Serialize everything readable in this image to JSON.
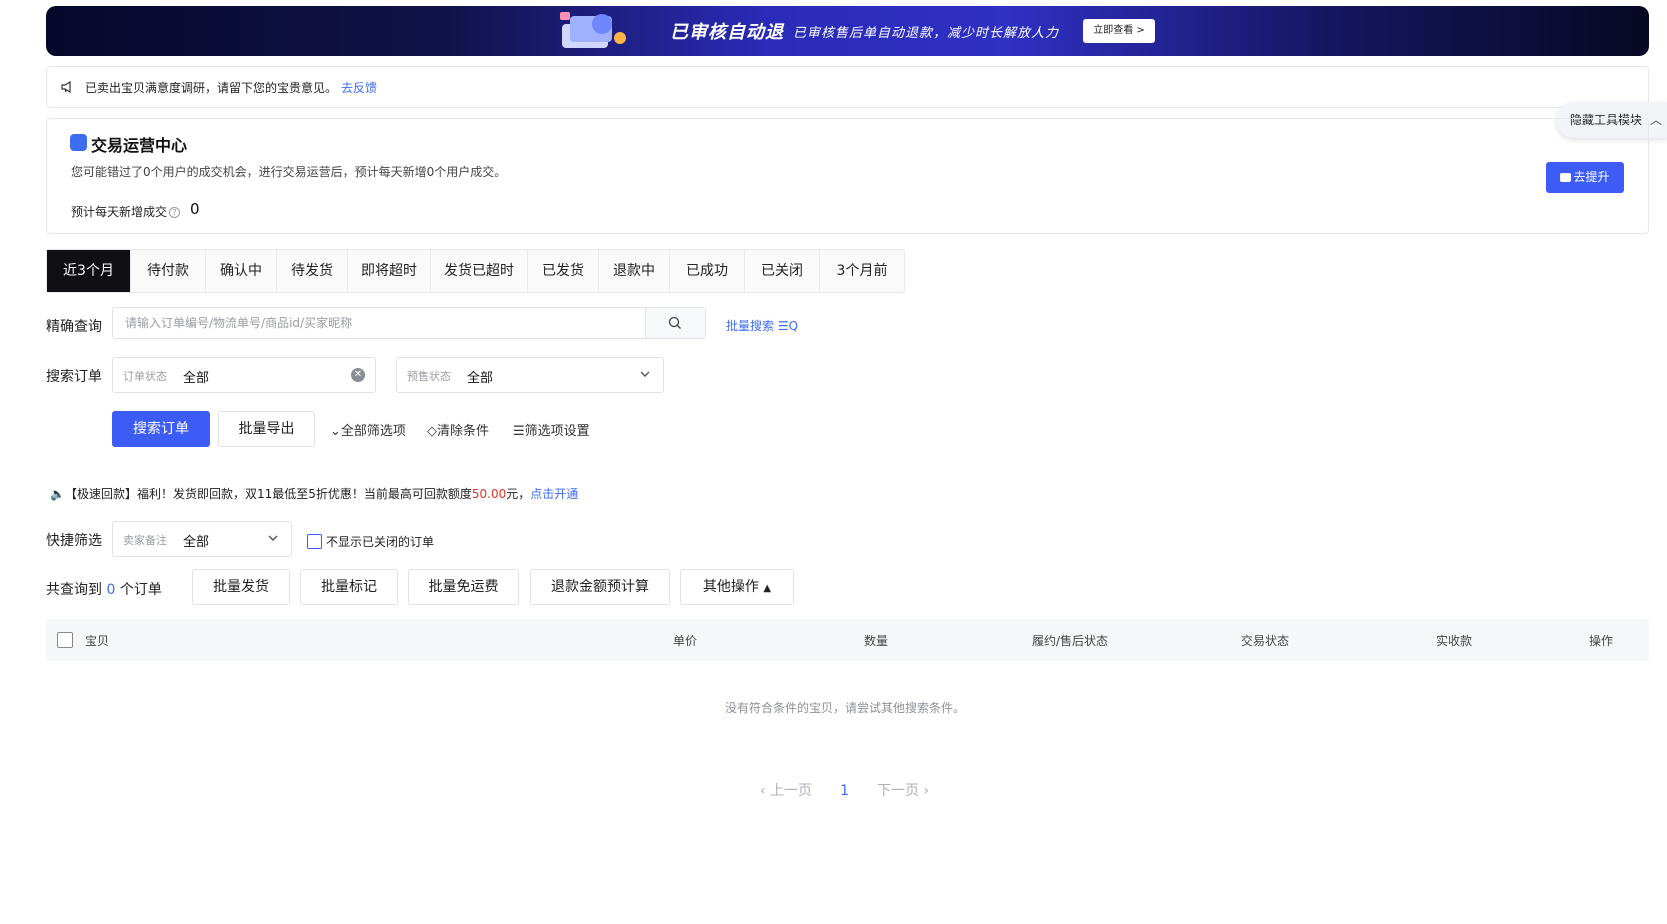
{
  "banner": {
    "title": "已审核自动退",
    "subtitle": "已审核售后单自动退款，减少时长解放人力",
    "button": "立即查看 >"
  },
  "feedback": {
    "text": "已卖出宝贝满意度调研，请留下您的宝贵意见。",
    "link": "去反馈"
  },
  "tools": {
    "hide_label": "隐藏工具模块"
  },
  "trade_center": {
    "title": "交易运营中心",
    "description": "您可能错过了0个用户的成交机会，进行交易运营后，预计每天新增0个用户成交。",
    "metric_label": "预计每天新增成交",
    "metric_value": "0",
    "button": "去提升"
  },
  "tabs": [
    {
      "label": "近3个月",
      "active": true
    },
    {
      "label": "待付款"
    },
    {
      "label": "确认中"
    },
    {
      "label": "待发货"
    },
    {
      "label": "即将超时"
    },
    {
      "label": "发货已超时"
    },
    {
      "label": "已发货"
    },
    {
      "label": "退款中"
    },
    {
      "label": "已成功"
    },
    {
      "label": "已关闭"
    },
    {
      "label": "3个月前"
    }
  ],
  "precise": {
    "label": "精确查询",
    "placeholder": "请输入订单编号/物流单号/商品id/买家昵称",
    "batch_search": "批量搜索"
  },
  "search": {
    "label": "搜索订单",
    "order_status_label": "订单状态",
    "order_status_value": "全部",
    "presale_label": "预售状态",
    "presale_value": "全部"
  },
  "actions": {
    "search": "搜索订单",
    "export": "批量导出",
    "all_filters": "全部筛选项",
    "clear": "清除条件",
    "settings": "筛选项设置"
  },
  "promo": {
    "prefix": "【极速回款】福利！发货即回款，双11最低至5折优惠！当前最高可回款额度",
    "amount": "50.00",
    "suffix": "元，",
    "link": "点击开通"
  },
  "quick": {
    "label": "快捷筛选",
    "note_label": "卖家备注",
    "note_value": "全部",
    "hide_closed": "不显示已关闭的订单"
  },
  "total": {
    "prefix": "共查询到",
    "count": "0",
    "suffix": "个订单"
  },
  "bulk": {
    "ship": "批量发货",
    "mark": "批量标记",
    "free_ship": "批量免运费",
    "refund_calc": "退款金额预计算",
    "other": "其他操作"
  },
  "table": {
    "columns": [
      "宝贝",
      "单价",
      "数量",
      "履约/售后状态",
      "交易状态",
      "实收款",
      "操作"
    ],
    "empty": "没有符合条件的宝贝，请尝试其他搜索条件。"
  },
  "pagination": {
    "prev": "上一页",
    "page": "1",
    "next": "下一页"
  },
  "colors": {
    "primary": "#3d5cf5",
    "link": "#3d6cf0",
    "danger": "#e0312b",
    "tab_active": "#0f0f14"
  }
}
